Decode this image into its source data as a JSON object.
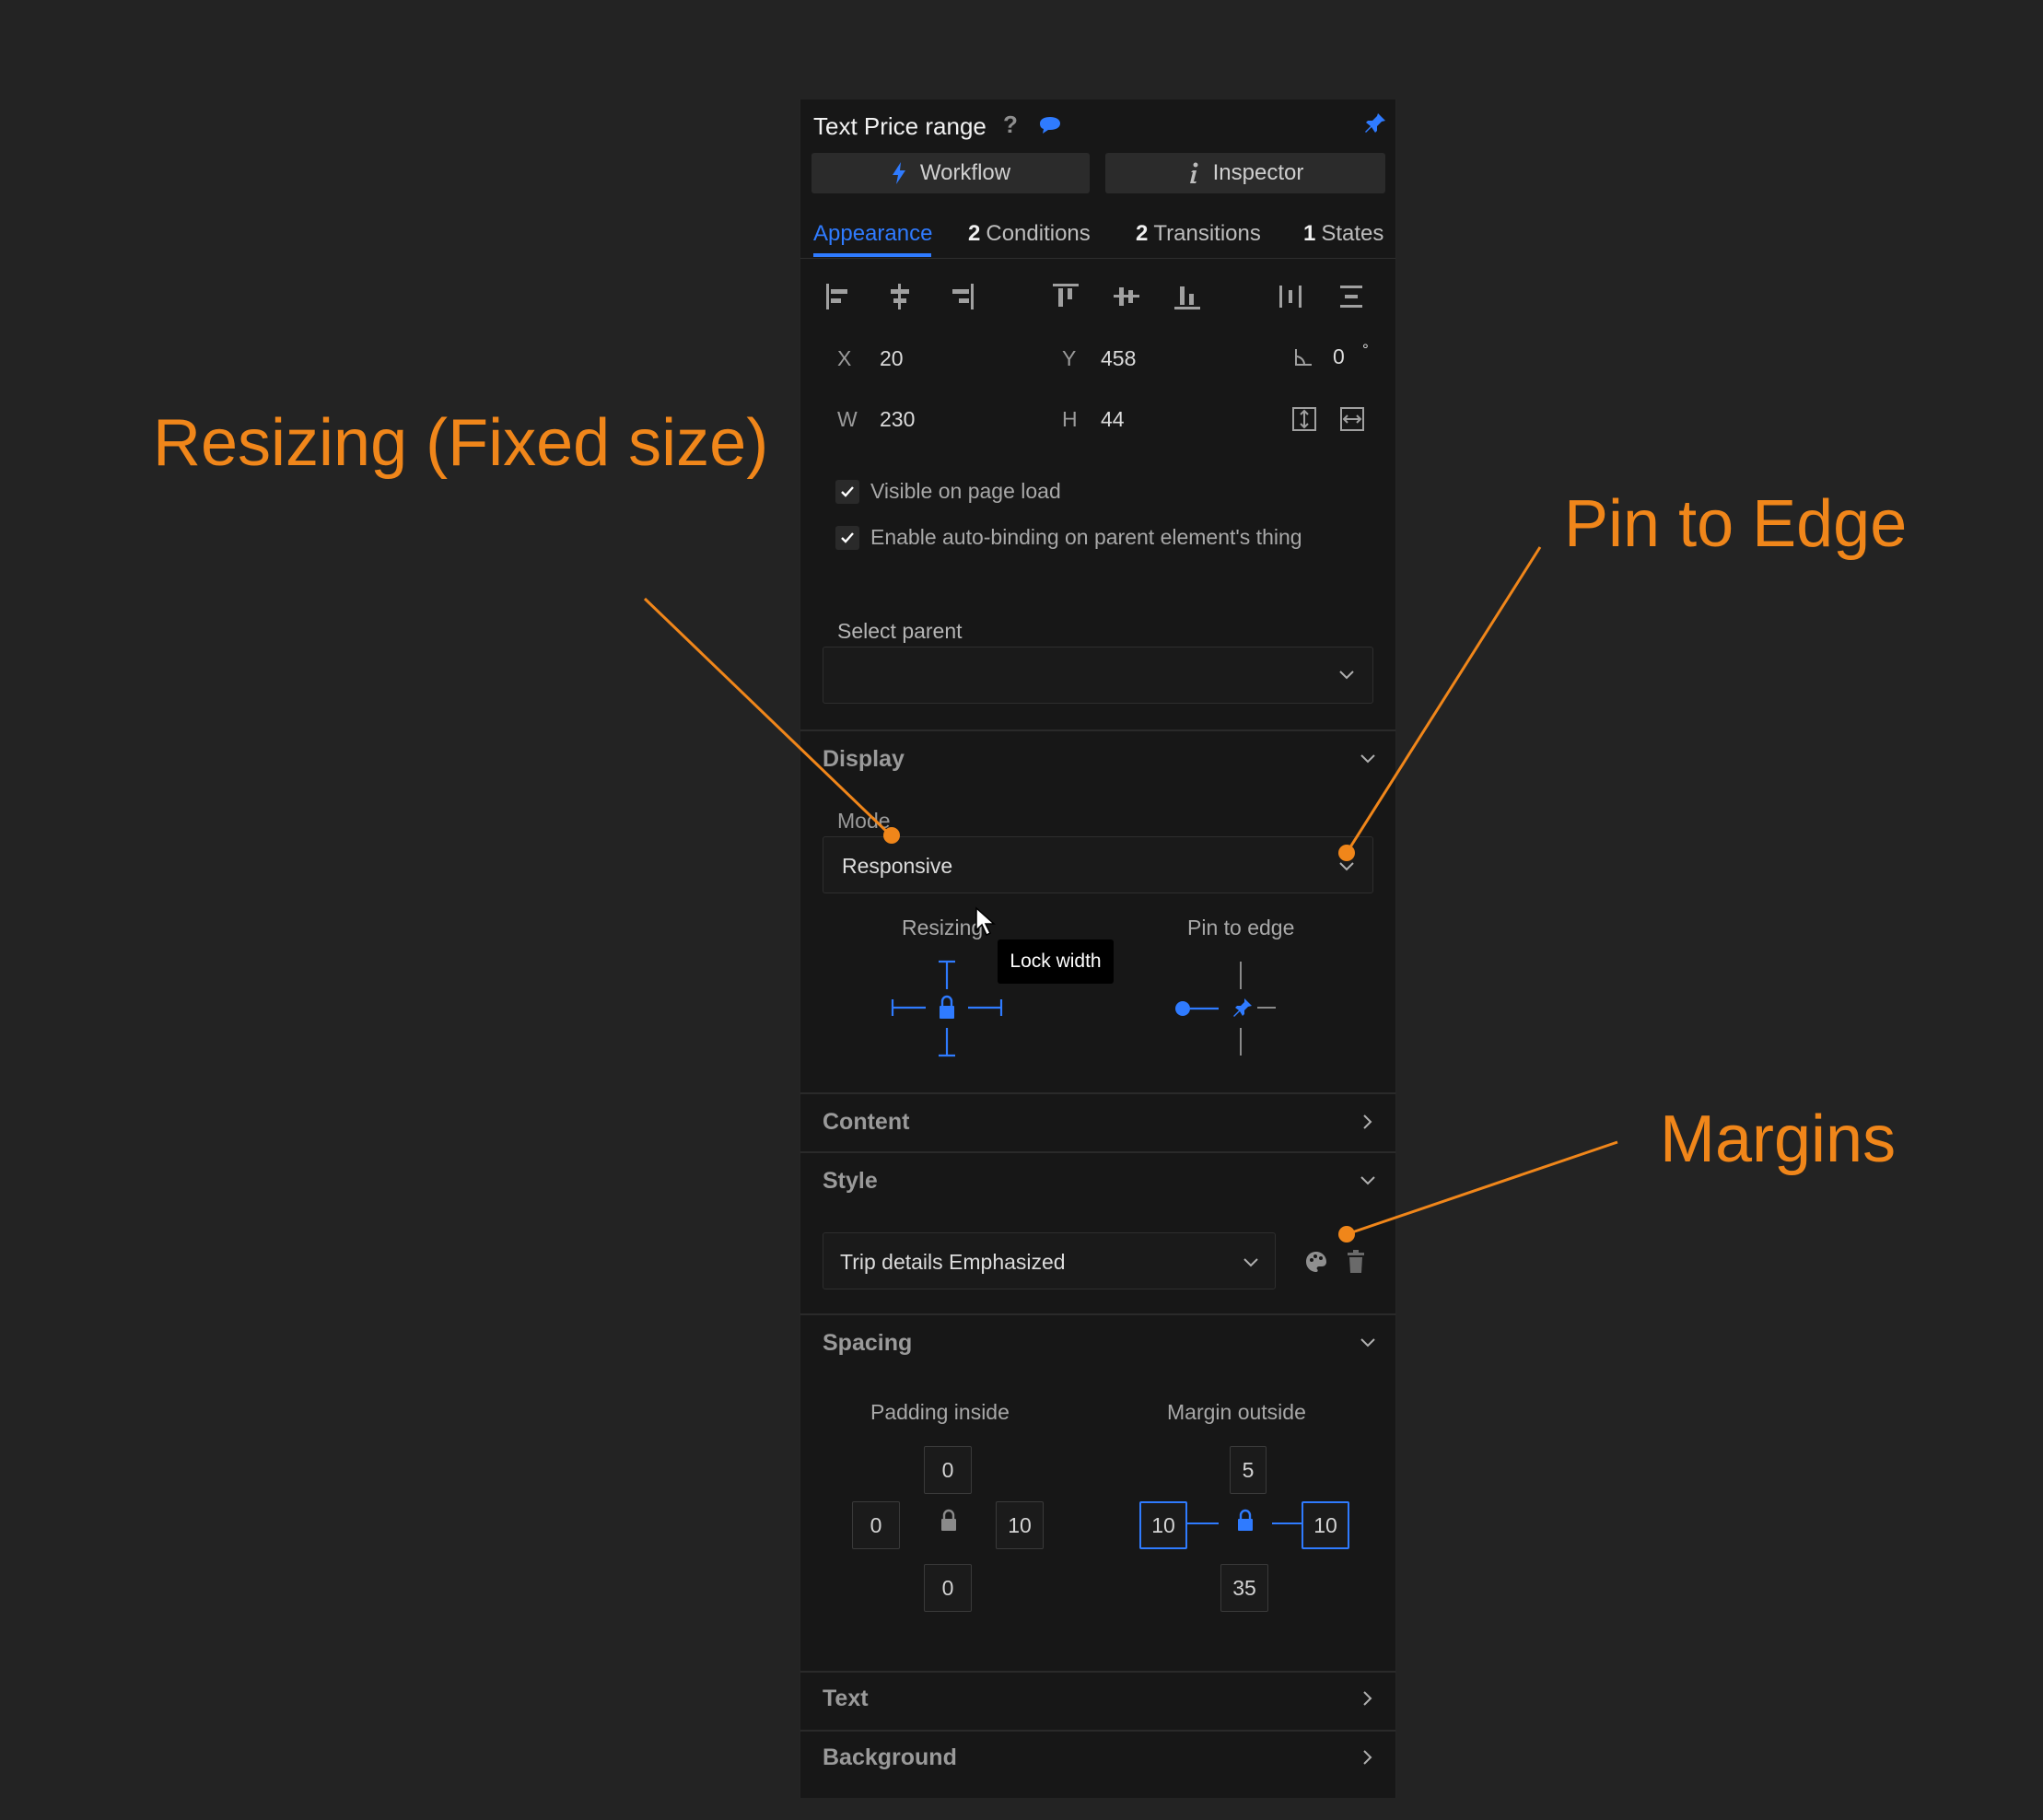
{
  "header": {
    "title": "Text Price range",
    "help": "?"
  },
  "buttons": {
    "workflow": "Workflow",
    "inspector": "Inspector"
  },
  "tabs": [
    {
      "count": "",
      "label": "Appearance",
      "active": true
    },
    {
      "count": "2",
      "label": "Conditions"
    },
    {
      "count": "2",
      "label": "Transitions"
    },
    {
      "count": "1",
      "label": "States"
    }
  ],
  "geometry_fields": {
    "x_label": "X",
    "x_value": "20",
    "y_label": "Y",
    "y_value": "458",
    "rotation_value": "0",
    "rotation_unit": "°",
    "w_label": "W",
    "w_value": "230",
    "h_label": "H",
    "h_value": "44"
  },
  "checkboxes": {
    "visible": "Visible on page load",
    "autobinding": "Enable auto-binding on parent element's thing"
  },
  "select_parent": {
    "label": "Select parent",
    "value": ""
  },
  "display": {
    "title": "Display",
    "mode_label": "Mode",
    "mode_value": "Responsive",
    "resizing_label": "Resizing",
    "pin_label": "Pin to edge",
    "tooltip": "Lock width"
  },
  "content": {
    "title": "Content"
  },
  "style": {
    "title": "Style",
    "value": "Trip details Emphasized"
  },
  "spacing": {
    "title": "Spacing",
    "padding_label": "Padding inside",
    "margin_label": "Margin outside",
    "padding": {
      "top": "0",
      "left": "0",
      "right": "10",
      "bottom": "0"
    },
    "margin": {
      "top": "5",
      "left": "10",
      "right": "10",
      "bottom": "35"
    }
  },
  "text_section": {
    "title": "Text"
  },
  "background_section": {
    "title": "Background"
  },
  "annotations": {
    "resizing": "Resizing (Fixed size)",
    "pin": "Pin to Edge",
    "margins": "Margins"
  },
  "colors": {
    "accent": "#2f7bff",
    "annotation": "#f0861a",
    "panel": "#171717",
    "background": "#232323"
  }
}
